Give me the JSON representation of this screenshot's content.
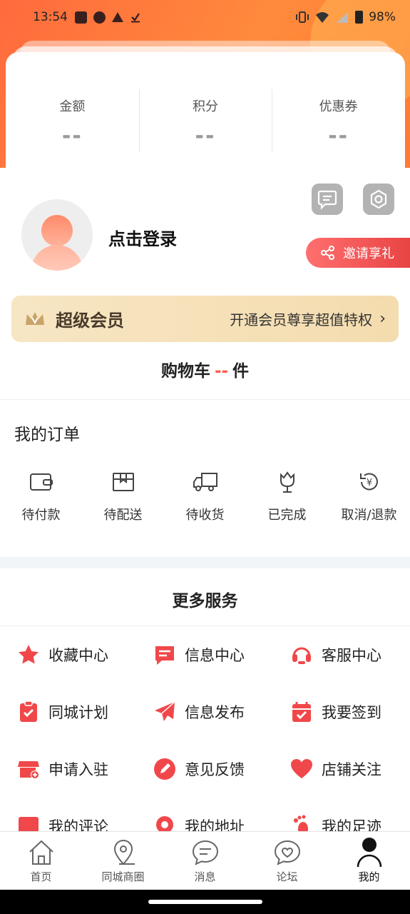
{
  "status_bar": {
    "time": "13:54",
    "battery": "98%"
  },
  "stats": [
    {
      "label": "金额",
      "value": "--"
    },
    {
      "label": "积分",
      "value": "--"
    },
    {
      "label": "优惠券",
      "value": "--"
    }
  ],
  "profile": {
    "login_label": "点击登录",
    "invite_label": "邀请享礼"
  },
  "vip": {
    "title": "超级会员",
    "desc": "开通会员尊享超值特权"
  },
  "cart": {
    "prefix": "购物车",
    "count": "--",
    "suffix": "件"
  },
  "orders": {
    "title": "我的订单",
    "items": [
      {
        "label": "待付款",
        "icon": "wallet-icon"
      },
      {
        "label": "待配送",
        "icon": "package-icon"
      },
      {
        "label": "待收货",
        "icon": "truck-icon"
      },
      {
        "label": "已完成",
        "icon": "flower-icon"
      },
      {
        "label": "取消/退款",
        "icon": "refund-icon"
      }
    ]
  },
  "services": {
    "title": "更多服务",
    "items": [
      {
        "label": "收藏中心",
        "icon": "star-icon"
      },
      {
        "label": "信息中心",
        "icon": "message-icon"
      },
      {
        "label": "客服中心",
        "icon": "headset-icon"
      },
      {
        "label": "同城计划",
        "icon": "clipboard-check-icon"
      },
      {
        "label": "信息发布",
        "icon": "paper-plane-icon"
      },
      {
        "label": "我要签到",
        "icon": "calendar-check-icon"
      },
      {
        "label": "申请入驻",
        "icon": "store-icon"
      },
      {
        "label": "意见反馈",
        "icon": "pencil-icon"
      },
      {
        "label": "店铺关注",
        "icon": "heart-icon"
      },
      {
        "label": "我的评论",
        "icon": "comment-icon"
      },
      {
        "label": "我的地址",
        "icon": "location-icon"
      },
      {
        "label": "我的足迹",
        "icon": "footprint-icon"
      }
    ]
  },
  "bottom_nav": [
    {
      "label": "首页",
      "icon": "home-icon"
    },
    {
      "label": "同城商圈",
      "icon": "map-pin-icon"
    },
    {
      "label": "消息",
      "icon": "chat-icon"
    },
    {
      "label": "论坛",
      "icon": "forum-heart-icon"
    },
    {
      "label": "我的",
      "icon": "user-icon",
      "active": true
    }
  ],
  "colors": {
    "accent": "#ff5a4a",
    "header": "#ff7a3c",
    "vip_bg": "#f6e2bb",
    "icon_red": "#f0484a"
  }
}
